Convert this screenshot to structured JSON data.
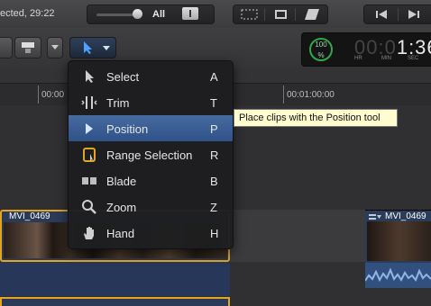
{
  "top": {
    "status_text": "ected, 29:22",
    "volume_label": "All"
  },
  "timecode": {
    "percent": "100",
    "percent_unit": "%",
    "dim_digits": "00:0",
    "bright_digits": "1:36",
    "sub_hr": "HR",
    "sub_min": "MIN",
    "sub_sec": "SEC"
  },
  "ruler": {
    "label1": "00:00",
    "label2": "00:01:00:00"
  },
  "clips": {
    "left_title": "MVI_0469",
    "right_title": "MVI_0469"
  },
  "menu": {
    "items": [
      {
        "label": "Select",
        "key": "A"
      },
      {
        "label": "Trim",
        "key": "T"
      },
      {
        "label": "Position",
        "key": "P"
      },
      {
        "label": "Range Selection",
        "key": "R"
      },
      {
        "label": "Blade",
        "key": "B"
      },
      {
        "label": "Zoom",
        "key": "Z"
      },
      {
        "label": "Hand",
        "key": "H"
      }
    ],
    "selected_index": 2
  },
  "tooltip": {
    "text": "Place clips with the Position tool"
  },
  "colors": {
    "selection": "#2f5288",
    "clip_border": "#e2a620",
    "tooltip_bg": "#fffcd0"
  }
}
